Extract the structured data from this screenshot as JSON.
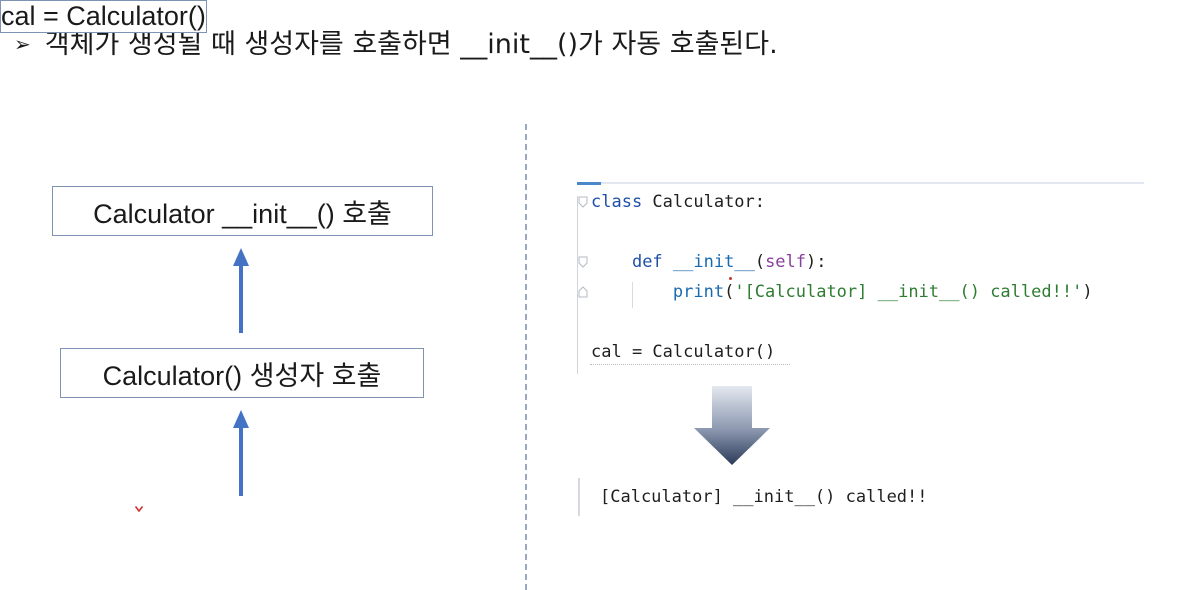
{
  "heading": {
    "bullet": "➢",
    "text": "객체가 생성될 때 생성자를 호출하면 __init__()가 자동 호출된다."
  },
  "flow": {
    "box_init": "Calculator __init__() 호출",
    "box_constructor": "Calculator() 생성자 호출",
    "box_call": "cal = Calculator()"
  },
  "code": {
    "line1_kw": "class",
    "line1_rest": " Calculator:",
    "line2_indent": "    ",
    "line2_kw": "def",
    "line2_sp": " ",
    "line2_fn": "__init__",
    "line2_open": "(",
    "line2_self": "self",
    "line2_close": "):",
    "line3_indent": "        ",
    "line3_fn": "print",
    "line3_open": "(",
    "line3_str": "'[Calculator] __init__() called!!'",
    "line3_close": ")",
    "line4": "cal = Calculator()"
  },
  "output": {
    "text": "[Calculator] __init__() called!!"
  },
  "colors": {
    "flow_arrow": "#4472c4",
    "box_border": "#7f93b3",
    "keyword": "#1f4fa8",
    "string": "#2e7d32",
    "self": "#8a3f9e",
    "down_arrow_top": "#dfe3ea",
    "down_arrow_bottom": "#2f3e5c"
  }
}
